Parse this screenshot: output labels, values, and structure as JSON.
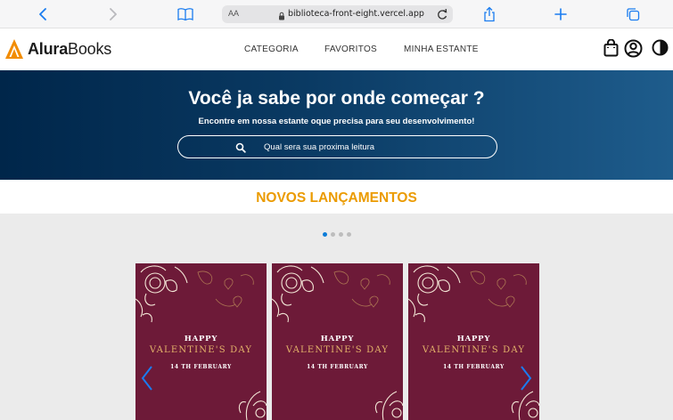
{
  "browser": {
    "text_size_label": "AA",
    "url": "biblioteca-front-eight.vercel.app"
  },
  "header": {
    "logo_bold": "Alura",
    "logo_light": "Books",
    "nav": [
      "CATEGORIA",
      "FAVORITOS",
      "MINHA ESTANTE"
    ]
  },
  "hero": {
    "title": "Você ja sabe por onde começar ?",
    "subtitle": "Encontre em nossa estante oque precisa para seu desenvolvimento!",
    "search_placeholder": "Qual sera sua proxima leitura"
  },
  "section": {
    "title": "NOVOS LANÇAMENTOS",
    "carousel_pages": 4,
    "active_page": 1
  },
  "cards": [
    {
      "line1": "HAPPY",
      "line2": "VALENTINE'S DAY",
      "line3": "14 TH FEBRUARY"
    },
    {
      "line1": "HAPPY",
      "line2": "VALENTINE'S DAY",
      "line3": "14 TH FEBRUARY"
    },
    {
      "line1": "HAPPY",
      "line2": "VALENTINE'S DAY",
      "line3": "14 TH FEBRUARY"
    }
  ],
  "colors": {
    "accent": "#eb9b00",
    "hero_dark": "#00264a",
    "card_bg": "#6d1a38",
    "ios_blue": "#0b7cd8"
  },
  "icons": [
    "back-icon",
    "forward-icon",
    "bookmarks-icon",
    "lock-icon",
    "reload-icon",
    "share-icon",
    "new-tab-icon",
    "tabs-icon",
    "bag-icon",
    "user-icon",
    "contrast-icon",
    "search-icon",
    "carousel-prev-icon",
    "carousel-next-icon"
  ]
}
